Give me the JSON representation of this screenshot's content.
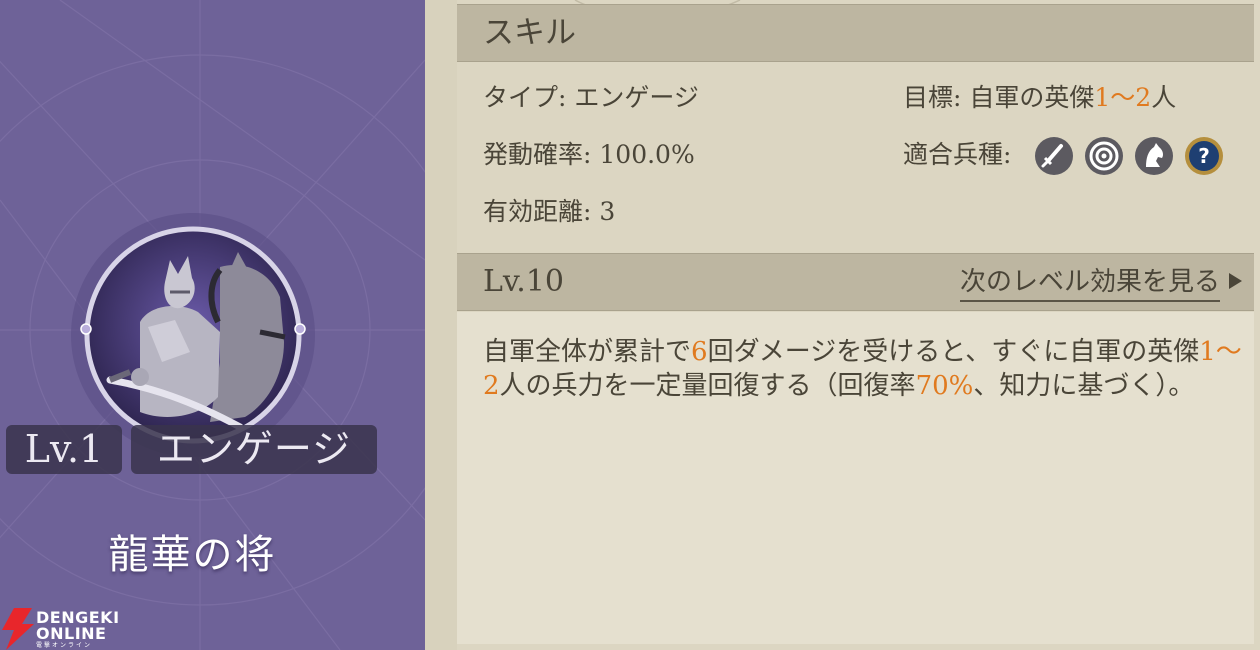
{
  "card": {
    "level_badge": "Lv.1",
    "type_badge": "エンゲージ",
    "skill_name": "龍華の将",
    "background_color": "#6e6298",
    "portrait_icon": "armored-general-on-horse"
  },
  "watermark": {
    "line1": "DENGEKI",
    "line2": "ONLINE",
    "line3": "電撃オンライン",
    "icon": "lightning-bolt-logo"
  },
  "panel": {
    "header": "スキル",
    "type_label": "タイプ:",
    "type_value": "エンゲージ",
    "target_label": "目標:",
    "target_prefix": "自軍の英傑",
    "target_range": "1～2",
    "target_suffix": "人",
    "rate_label": "発動確率:",
    "rate_value": "100.0%",
    "unit_label": "適合兵種:",
    "unit_icons": [
      "sword-icon",
      "bow-target-icon",
      "horse-icon",
      "question-icon"
    ],
    "range_label": "有効距離:",
    "range_value": "3",
    "level_header": "Lv.10",
    "next_level_link": "次のレベル効果を見る",
    "desc": {
      "p1": "自軍全体が累計で",
      "hits": "6",
      "p2": "回ダメージを受けると、すぐに自軍の英傑",
      "heroes": "1～2",
      "p3": "人の兵力を一定量回復する（回復率",
      "heal_rate": "70%",
      "p4": "、知力に基づく）。"
    },
    "highlight_color": "#e07a1f"
  }
}
